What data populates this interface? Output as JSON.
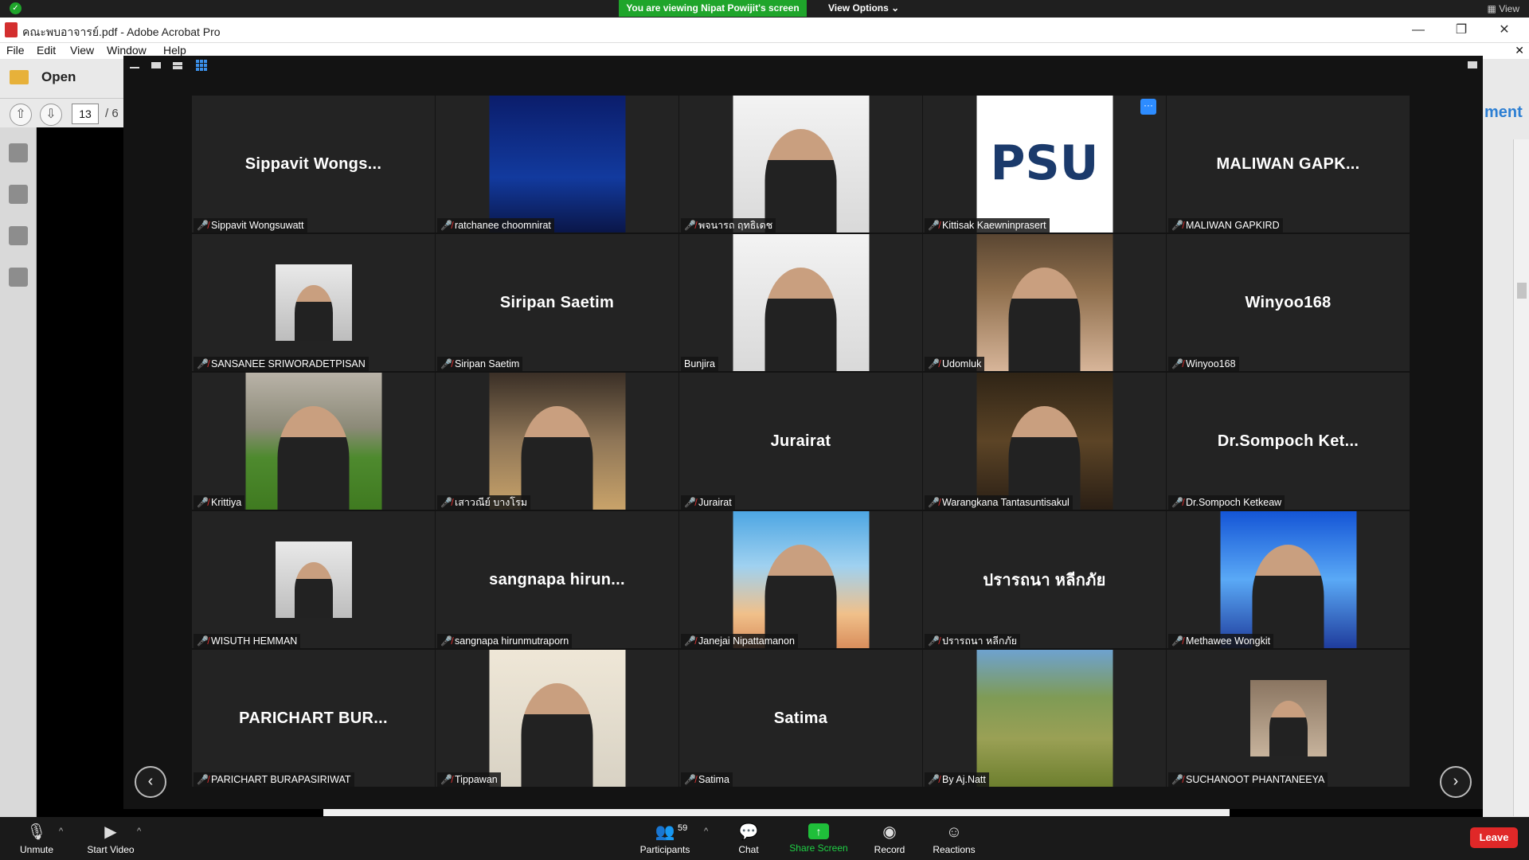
{
  "share_bar": {
    "viewing_text": "You are viewing Nipat Powijit's screen",
    "view_options": "View Options ⌄",
    "view_label": "View"
  },
  "acrobat": {
    "title": "คณะพบอาจารย์.pdf - Adobe Acrobat Pro",
    "menu": [
      "File",
      "Edit",
      "View",
      "Window",
      "Help"
    ],
    "open_label": "Open",
    "page_number": "13",
    "page_sep": "/ 6",
    "right_pane_text": "ment"
  },
  "gallery": {
    "tiles": [
      {
        "name": "Sippavit Wongsuwatt",
        "display": "Sippavit  Wongs...",
        "muted": true
      },
      {
        "name": "ratchanee choomnirat",
        "photo": "ph-chart",
        "muted": true
      },
      {
        "name": "พจนารถ ฤทธิเดช",
        "photo": "ph-light",
        "muted": true
      },
      {
        "name": "Kittisak Kaewninprasert",
        "photo": "ph-psu",
        "muted": true,
        "psu_text": "PSU"
      },
      {
        "name": "MALIWAN GAPKIRD",
        "display": "MALIWAN  GAPK...",
        "muted": true
      },
      {
        "name": "SANSANEE SRIWORADETPISAN",
        "photo": "ph-portrait",
        "small": true,
        "muted": true
      },
      {
        "name": "Siripan Saetim",
        "display": "Siripan Saetim",
        "muted": true
      },
      {
        "name": "Bunjira",
        "photo": "ph-light",
        "muted": false
      },
      {
        "name": "Udomluk",
        "photo": "ph-library",
        "muted": true
      },
      {
        "name": "Winyoo168",
        "display": "Winyoo168",
        "muted": true
      },
      {
        "name": "Krittiya",
        "photo": "ph-park",
        "muted": true
      },
      {
        "name": "เสาวณีย์ บางโรม",
        "photo": "ph-desk",
        "muted": true
      },
      {
        "name": "Jurairat",
        "display": "Jurairat",
        "muted": true
      },
      {
        "name": "Warangkana Tantasuntisakul",
        "photo": "ph-cafe",
        "muted": true
      },
      {
        "name": "Dr.Sompoch  Ketkeaw",
        "display": "Dr.Sompoch   Ket...",
        "muted": true
      },
      {
        "name": "WISUTH HEMMAN",
        "photo": "ph-portrait",
        "small": true,
        "muted": true
      },
      {
        "name": "sangnapa hirunmutraporn",
        "display": "sangnapa  hirun...",
        "muted": true
      },
      {
        "name": "Janejai Nipattamanon",
        "photo": "ph-beach",
        "muted": true
      },
      {
        "name": "ปรารถนา หลีกภัย",
        "display": "ปรารถนา หลีกภัย",
        "muted": true
      },
      {
        "name": "Methawee Wongkit",
        "photo": "ph-blue",
        "muted": true
      },
      {
        "name": "PARICHART BURAPASIRIWAT",
        "display": "PARICHART  BUR...",
        "muted": true
      },
      {
        "name": "Tippawan",
        "photo": "ph-paint",
        "muted": true
      },
      {
        "name": "Satima",
        "display": "Satima",
        "muted": true
      },
      {
        "name": "By Aj.Natt",
        "photo": "ph-garden",
        "muted": true
      },
      {
        "name": "SUCHANOOT PHANTANEEYA",
        "photo": "ph-room",
        "small": true,
        "muted": true
      }
    ],
    "more_label": "···",
    "prev_icon": "‹",
    "next_icon": "›"
  },
  "controls": {
    "unmute": "Unmute",
    "start_video": "Start Video",
    "participants": "Participants",
    "participant_count": "59",
    "chat": "Chat",
    "share_screen": "Share Screen",
    "record": "Record",
    "reactions": "Reactions",
    "leave": "Leave"
  }
}
